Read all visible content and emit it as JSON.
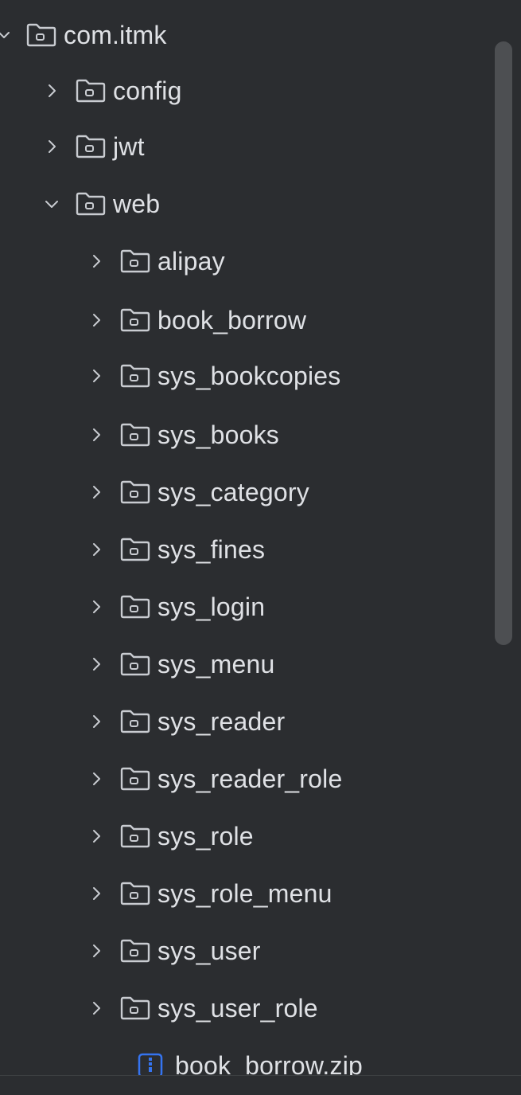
{
  "tree": {
    "root": {
      "label": "com.itmk",
      "expanded": true
    },
    "level1": [
      {
        "label": "config",
        "expanded": false
      },
      {
        "label": "jwt",
        "expanded": false
      },
      {
        "label": "web",
        "expanded": true
      }
    ],
    "web_children": [
      {
        "label": "alipay"
      },
      {
        "label": "book_borrow"
      },
      {
        "label": "sys_bookcopies"
      },
      {
        "label": "sys_books"
      },
      {
        "label": "sys_category"
      },
      {
        "label": "sys_fines"
      },
      {
        "label": "sys_login"
      },
      {
        "label": "sys_menu"
      },
      {
        "label": "sys_reader"
      },
      {
        "label": "sys_reader_role"
      },
      {
        "label": "sys_role"
      },
      {
        "label": "sys_role_menu"
      },
      {
        "label": "sys_user"
      },
      {
        "label": "sys_user_role"
      }
    ],
    "file": {
      "label": "book_borrow.zip",
      "icon": "zip-file-icon"
    }
  },
  "colors": {
    "background": "#2b2d30",
    "text": "#dfe1e5",
    "icon": "#c9ccd1",
    "zip_icon": "#3574f0"
  }
}
